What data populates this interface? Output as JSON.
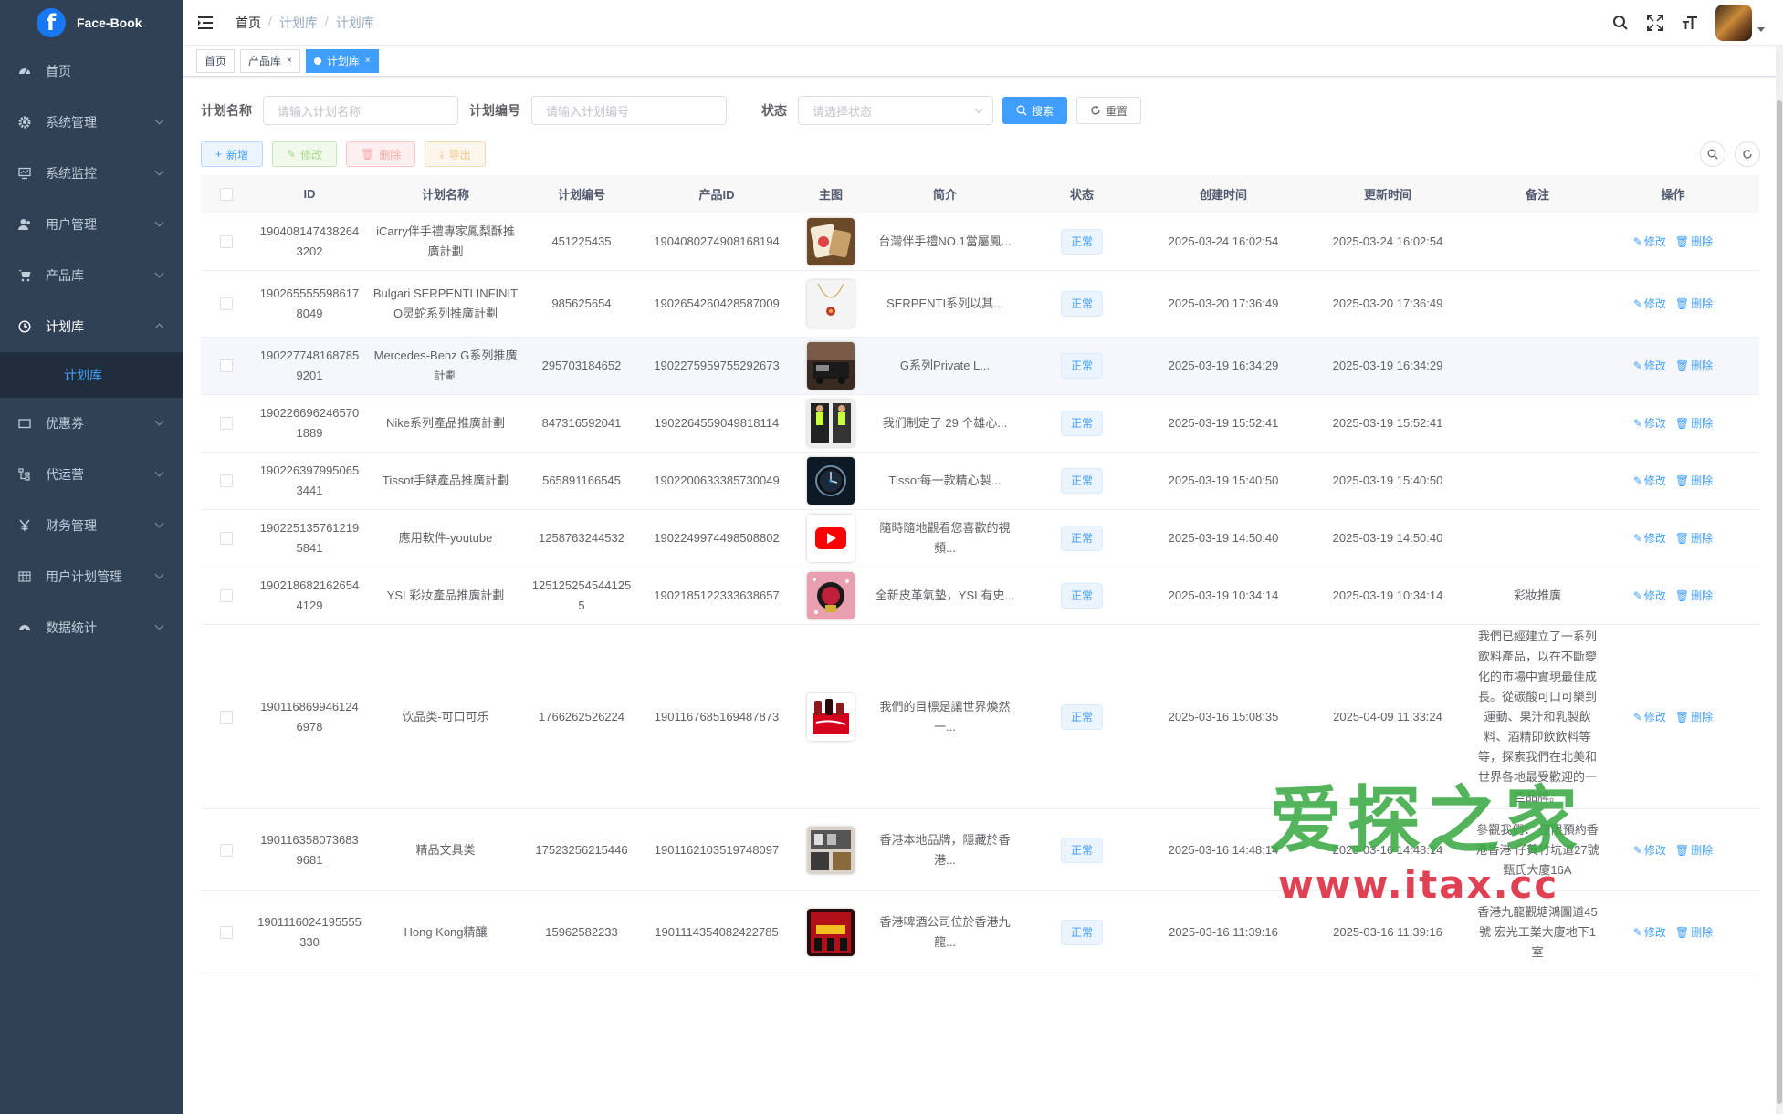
{
  "app": {
    "logo_text": "Face-Book",
    "logo_letter": "f"
  },
  "sidebar": {
    "items": [
      {
        "label": "首页",
        "icon": "dashboard-icon"
      },
      {
        "label": "系统管理",
        "icon": "gear-icon"
      },
      {
        "label": "系统监控",
        "icon": "monitor-icon"
      },
      {
        "label": "用户管理",
        "icon": "user-icon"
      },
      {
        "label": "产品库",
        "icon": "cart-icon"
      },
      {
        "label": "计划库",
        "icon": "clock-icon"
      },
      {
        "label": "优惠券",
        "icon": "coupon-icon"
      },
      {
        "label": "代运营",
        "icon": "tree-icon"
      },
      {
        "label": "财务管理",
        "icon": "yen-icon"
      },
      {
        "label": "用户计划管理",
        "icon": "table-icon"
      },
      {
        "label": "数据统计",
        "icon": "chart-icon"
      }
    ],
    "submenu_active": "计划库"
  },
  "breadcrumb": [
    "首页",
    "计划库",
    "计划库"
  ],
  "tags": [
    {
      "label": "首页"
    },
    {
      "label": "产品库"
    },
    {
      "label": "计划库"
    }
  ],
  "search": {
    "name_label": "计划名称",
    "name_placeholder": "请输入计划名称",
    "code_label": "计划编号",
    "code_placeholder": "请输入计划编号",
    "status_label": "状态",
    "status_placeholder": "请选择状态",
    "search_btn": "搜索",
    "reset_btn": "重置"
  },
  "toolbar": {
    "add": "新增",
    "edit": "修改",
    "delete": "删除",
    "export": "导出"
  },
  "table": {
    "headers": [
      "ID",
      "计划名称",
      "计划编号",
      "产品ID",
      "主图",
      "简介",
      "状态",
      "创建时间",
      "更新时间",
      "备注",
      "操作"
    ],
    "op_edit": "修改",
    "op_delete": "删除",
    "rows": [
      {
        "id": "1904081474382643202",
        "name": "iCarry伴手禮專家鳳梨酥推廣計劃",
        "code": "451225435",
        "pid": "1904080274908168194",
        "intro": "台灣伴手禮NO.1當屬鳳...",
        "status": "正常",
        "created": "2025-03-24 16:02:54",
        "updated": "2025-03-24 16:02:54",
        "remark": "",
        "img": "pineapple-cake"
      },
      {
        "id": "1902655555986178049",
        "name": "Bulgari SERPENTI INFINITO灵蛇系列推廣計劃",
        "code": "985625654",
        "pid": "1902654260428587009",
        "intro": "SERPENTI系列以其...",
        "status": "正常",
        "created": "2025-03-20 17:36:49",
        "updated": "2025-03-20 17:36:49",
        "remark": "",
        "img": "necklace"
      },
      {
        "id": "1902277481687859201",
        "name": "Mercedes-Benz G系列推廣計劃",
        "code": "295703184652",
        "pid": "1902275959755292673",
        "intro": "G系列Private L...",
        "status": "正常",
        "created": "2025-03-19 16:34:29",
        "updated": "2025-03-19 16:34:29",
        "remark": "",
        "img": "car"
      },
      {
        "id": "1902266962465701889",
        "name": "Nike系列產品推廣計劃",
        "code": "847316592041",
        "pid": "1902264559049818114",
        "intro": "我们制定了 29 个雄心...",
        "status": "正常",
        "created": "2025-03-19 15:52:41",
        "updated": "2025-03-19 15:52:41",
        "remark": "",
        "img": "nike"
      },
      {
        "id": "1902263979950653441",
        "name": "Tissot手錶產品推廣計劃",
        "code": "565891166545",
        "pid": "1902200633385730049",
        "intro": "Tissot每一款精心製...",
        "status": "正常",
        "created": "2025-03-19 15:40:50",
        "updated": "2025-03-19 15:40:50",
        "remark": "",
        "img": "watch"
      },
      {
        "id": "1902251357612195841",
        "name": "應用軟件-youtube",
        "code": "1258763244532",
        "pid": "1902249974498508802",
        "intro": "隨時隨地觀看您喜歡的視頻...",
        "status": "正常",
        "created": "2025-03-19 14:50:40",
        "updated": "2025-03-19 14:50:40",
        "remark": "",
        "img": "youtube"
      },
      {
        "id": "1902186821626544129",
        "name": "YSL彩妝產品推廣計劃",
        "code": "1251252545441255",
        "pid": "1902185122333638657",
        "intro": "全新皮革氣墊，YSL有史...",
        "status": "正常",
        "created": "2025-03-19 10:34:14",
        "updated": "2025-03-19 10:34:14",
        "remark": "彩妝推廣",
        "img": "ysl"
      },
      {
        "id": "1901168699461246978",
        "name": "饮品类-可口可乐",
        "code": "1766262526224",
        "pid": "1901167685169487873",
        "intro": "我們的目標是讓世界煥然一...",
        "status": "正常",
        "created": "2025-03-16 15:08:35",
        "updated": "2025-04-09 11:33:24",
        "remark": "我們已經建立了一系列飲料產品，以在不斷變化的市場中實現最佳成長。從碳酸可口可樂到運動、果汁和乳製飲料、酒精即飲飲料等等，探索我們在北美和世界各地最受歡迎的一些品牌。",
        "img": "coke"
      },
      {
        "id": "1901163580736839681",
        "name": "精品文具类",
        "code": "17523256215446",
        "pid": "1901162103519748097",
        "intro": "香港本地品牌，隱藏於香港...",
        "status": "正常",
        "created": "2025-03-16 14:48:14",
        "updated": "2025-03-16 14:48:14",
        "remark": "參觀我們： 僅限預約香港香港 仔黃竹坑道27號甄氏大廈16A",
        "img": "stationery"
      },
      {
        "id": "1901116024195555330",
        "name": "Hong Kong精釀",
        "code": "15962582233",
        "pid": "1901114354082422785",
        "intro": "香港啤酒公司位於香港九龍...",
        "status": "正常",
        "created": "2025-03-16 11:39:16",
        "updated": "2025-03-16 11:39:16",
        "remark": "香港九龍觀塘鴻圖道45號 宏光工業大廈地下1室",
        "img": "beer"
      }
    ]
  },
  "watermark": {
    "line1": "爱探之家",
    "line2": "www.itax.cc"
  }
}
